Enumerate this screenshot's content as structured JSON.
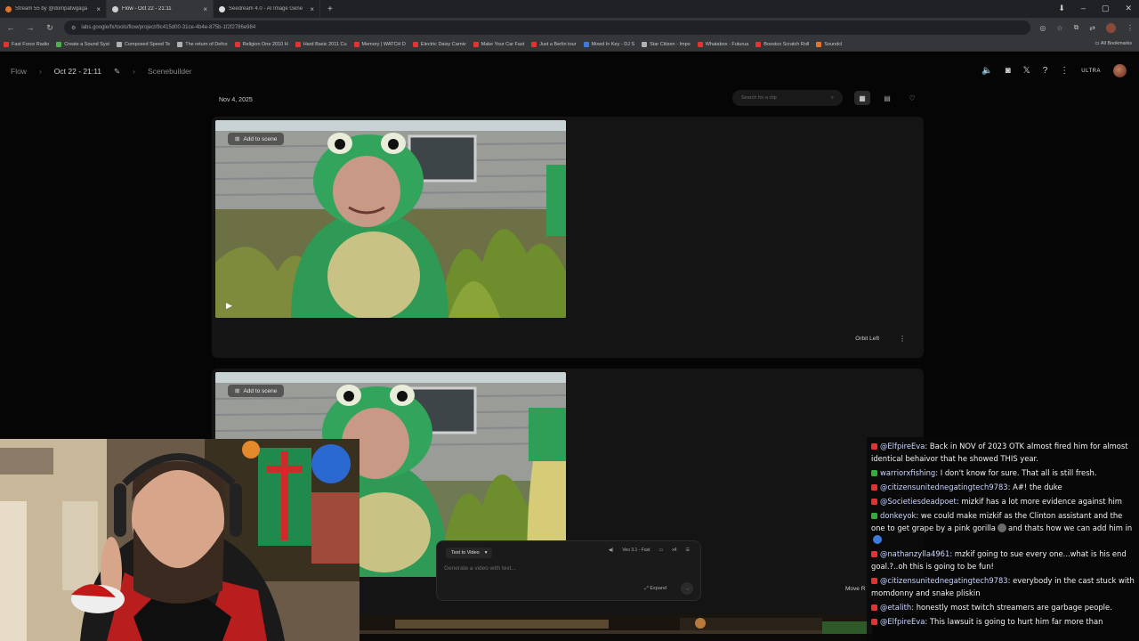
{
  "browser": {
    "tabs": [
      {
        "title": "Stream 55 by @dompatwgaga",
        "color": "#e0742d",
        "active": false
      },
      {
        "title": "Flow - Oct 22 - 21:11",
        "color": "#cfcfcf",
        "active": true
      },
      {
        "title": "Seedream 4.0 - AI Image Gene",
        "color": "#dddddd",
        "active": false
      }
    ],
    "new_tab": "+",
    "url": "labs.google/fx/tools/flow/project/9c415d00-31ce-4b4e-875b-1f2f2786e984",
    "bookmarks": [
      {
        "label": "Fast Force Radio",
        "color": "#e5312f"
      },
      {
        "label": "Create a Sound Syst",
        "color": "#4caf50"
      },
      {
        "label": "Composed Speed Te",
        "color": "#b0b0b0"
      },
      {
        "label": "The return of Defco",
        "color": "#b0b0b0"
      },
      {
        "label": "Religion One 2010 H",
        "color": "#e5312f"
      },
      {
        "label": "Hard Basic 2011 Cu",
        "color": "#e5312f"
      },
      {
        "label": "Memory | WATCH D",
        "color": "#e5312f"
      },
      {
        "label": "Electric Daisy Carniv",
        "color": "#e5312f"
      },
      {
        "label": "Make Your Car Fast",
        "color": "#e5312f"
      },
      {
        "label": "Just a Berlin tour",
        "color": "#e5312f"
      },
      {
        "label": "Mixed In Key - DJ S",
        "color": "#3b7be0"
      },
      {
        "label": "Star Citizen - Impo",
        "color": "#b0b0b0"
      },
      {
        "label": "Whatabox - Futurua",
        "color": "#e5312f"
      },
      {
        "label": "Boostco Scratch Roll",
        "color": "#e5312f"
      },
      {
        "label": "Soundcl",
        "color": "#e0742d"
      }
    ],
    "all_bookmarks": "All Bookmarks"
  },
  "app": {
    "breadcrumb": [
      "Flow",
      "Oct 22 - 21:11",
      "Scenebuilder"
    ],
    "ultra_label": "ULTRA",
    "date_label": "Nov 4, 2025",
    "search_placeholder": "Search for a clip",
    "scenes": [
      {
        "add_label": "Add to scene",
        "camera_label": "Orbit Left"
      },
      {
        "add_label": "Add to scene",
        "camera_label": "Move R"
      }
    ],
    "prompt": {
      "mode": "Text to Video",
      "model": "Veo 3.1 - Fast",
      "count": "x4",
      "placeholder": "Generate a video with text...",
      "expand": "Expand"
    }
  },
  "chat": [
    {
      "platform": "yt",
      "user": "@ElfpireEva",
      "text": "Back in NOV of 2023 OTK almost fired him for almost identical behaivor that he showed THIS year."
    },
    {
      "platform": "tw",
      "user": "warriorxfishing",
      "text": "I don't know for sure. That all is still fresh."
    },
    {
      "platform": "yt",
      "user": "@citizensunitednegatingtech9783",
      "text": "A#! the duke"
    },
    {
      "platform": "yt",
      "user": "@Societiesdeadpoet",
      "text": "mizkif has a lot more evidence against him"
    },
    {
      "platform": "tw",
      "user": "donkeyok",
      "text": "we could make mizkif as the Clinton assistant and the one to get grape by a pink gorilla",
      "text2": "and thats how we can add him in"
    },
    {
      "platform": "yt",
      "user": "@nathanzylla4961",
      "text": "mzkif going to sue every one...what is his end goal.?..oh this is going to be fun!"
    },
    {
      "platform": "yt",
      "user": "@citizensunitednegatingtech9783",
      "text": "everybody in the cast stuck with momdonny and snake pliskin"
    },
    {
      "platform": "yt",
      "user": "@etalith",
      "text": "honestly most twitch streamers are garbage people."
    },
    {
      "platform": "yt",
      "user": "@ElfpireEva",
      "text": "This lawsuit is going to hurt him far more than"
    }
  ]
}
